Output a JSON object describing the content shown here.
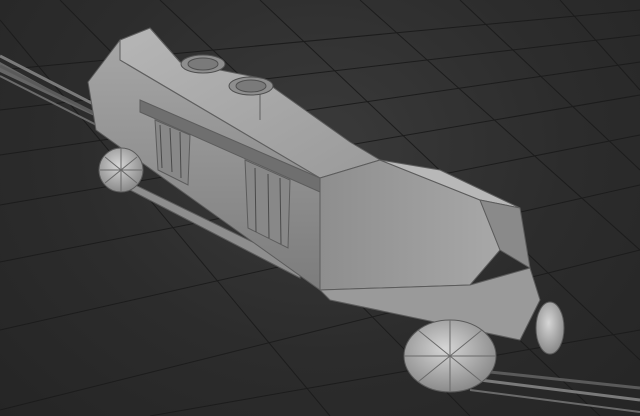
{
  "viewport": {
    "background_color": "#2e2e2e",
    "grid_color": "#1e1e1e",
    "wire_color": "#6a6a6a",
    "model_color": "#9c9c9c",
    "model_shadow_color": "#6e6e6e",
    "model_highlight_color": "#c4c4c4"
  },
  "scene": {
    "object_icon": "train-model-icon",
    "grid_icon": "perspective-grid-icon",
    "rail_icon": "rail-track-icon",
    "fan_icon": "fan-vent-icon",
    "wheel_icon": "wheel-pod-icon"
  }
}
